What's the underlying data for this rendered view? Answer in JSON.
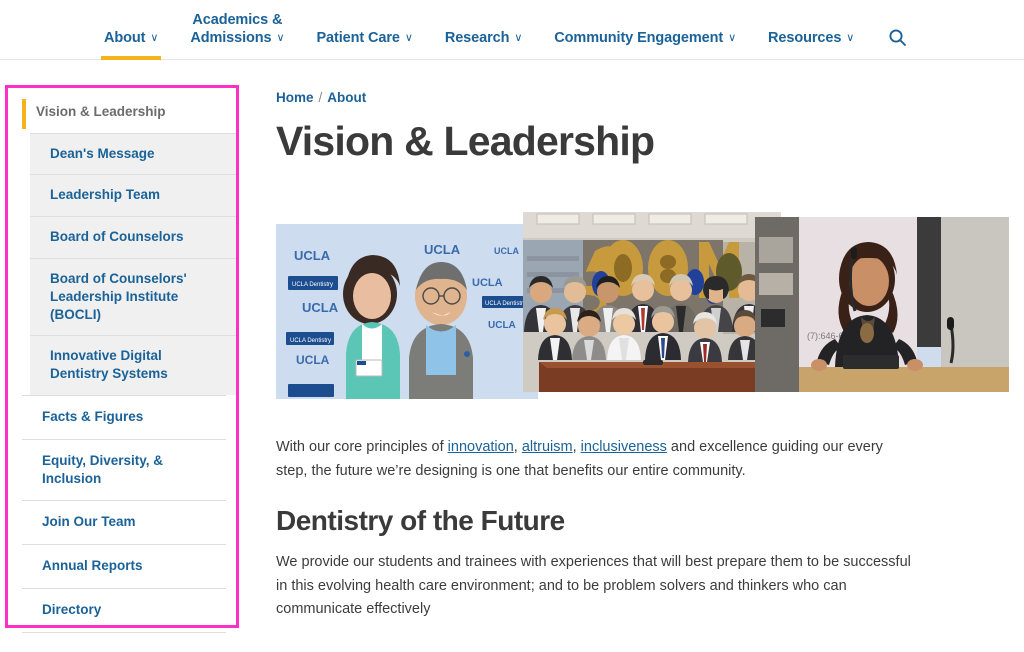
{
  "nav": {
    "items": [
      {
        "label": "About",
        "caret": "∨",
        "active": true
      },
      {
        "label_line1": "Academics &",
        "label_line2": "Admissions",
        "caret": "∨",
        "active": false
      },
      {
        "label": "Patient Care",
        "caret": "∨",
        "active": false
      },
      {
        "label": "Research",
        "caret": "∨",
        "active": false
      },
      {
        "label": "Community Engagement",
        "caret": "∨",
        "active": false
      },
      {
        "label": "Resources",
        "caret": "∨",
        "active": false
      }
    ],
    "search_icon": "search-icon",
    "active_underline_color": "#f5b21d",
    "link_color": "#1b6298"
  },
  "sidebar": {
    "highlight_color": "#ff2ec4",
    "accent_bar_color": "#f5b21d",
    "current": "Vision & Leadership",
    "sub_items": [
      {
        "label": "Dean's Message"
      },
      {
        "label": "Leadership Team"
      },
      {
        "label": "Board of Counselors"
      },
      {
        "label": "Board of Counselors' Leadership Institute (BOCLI)"
      },
      {
        "label": "Innovative Digital Dentistry Systems"
      }
    ],
    "main_items": [
      {
        "label": "Facts & Figures"
      },
      {
        "label": "Equity, Diversity, & Inclusion"
      },
      {
        "label": "Join Our Team"
      },
      {
        "label": "Annual Reports"
      },
      {
        "label": "Directory"
      }
    ]
  },
  "breadcrumb": {
    "home": "Home",
    "separator": "/",
    "current": "About"
  },
  "main": {
    "title": "Vision & Leadership",
    "collage": [
      {
        "name": "photo-ucla-backdrop-couple",
        "alt": "Two people posing in front of a UCLA School of Dentistry step-and-repeat backdrop",
        "backdrop_text": "UCLA",
        "backdrop_subtext": "Dentistry"
      },
      {
        "name": "photo-group-35m-balloons",
        "alt": "Group of people seated and standing at a conference table beneath gold balloons",
        "balloon_text": "$35M"
      },
      {
        "name": "photo-speaker-podium",
        "alt": "A woman speaking at a wooden lectern with a microphone in front of a projection screen"
      }
    ],
    "intro": {
      "before": "With our core principles of ",
      "link1": "innovation",
      "sep1": ", ",
      "link2": "altruism",
      "sep2": ", ",
      "link3": "inclusiveness",
      "after": " and excellence guiding our every step, the future we’re designing is one that benefits our entire community."
    },
    "section_heading": "Dentistry of the Future",
    "section_paragraph": "We provide our students and trainees with experiences that will best prepare them to be successful in this evolving health care environment; and to be problem solvers and thinkers who can communicate effectively"
  }
}
